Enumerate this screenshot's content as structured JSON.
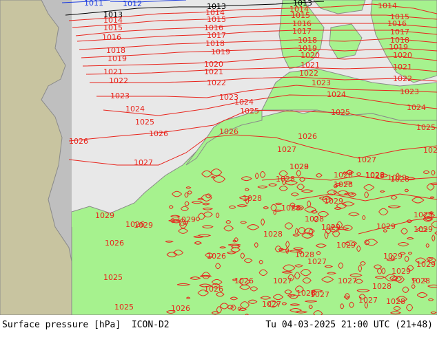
{
  "map": {
    "colors": {
      "land": "#a6f28e",
      "sea": "#e8e8e8",
      "outside_domain": "#bfbfbf",
      "outside_land": "#c8c4a0",
      "isobar_high": "#e8241c",
      "isobar_std": "#000000",
      "isobar_low": "#1f3fe0",
      "coast": "#8a8a8a"
    },
    "standard_isobar_hpa": 1013,
    "isobars": [
      {
        "value": "1011",
        "color": "low"
      },
      {
        "value": "1012",
        "color": "low"
      },
      {
        "value": "1013",
        "color": "std"
      },
      {
        "value": "1014",
        "color": "high"
      },
      {
        "value": "1015",
        "color": "high"
      },
      {
        "value": "1016",
        "color": "high"
      },
      {
        "value": "1017",
        "color": "high"
      },
      {
        "value": "1018",
        "color": "high"
      },
      {
        "value": "1019",
        "color": "high"
      },
      {
        "value": "1020",
        "color": "high"
      },
      {
        "value": "1021",
        "color": "high"
      },
      {
        "value": "1022",
        "color": "high"
      },
      {
        "value": "1023",
        "color": "high"
      },
      {
        "value": "1024",
        "color": "high"
      },
      {
        "value": "1025",
        "color": "high"
      },
      {
        "value": "1026",
        "color": "high"
      },
      {
        "value": "1027",
        "color": "high"
      },
      {
        "value": "1028",
        "color": "high"
      },
      {
        "value": "1029",
        "color": "high"
      }
    ]
  },
  "footer": {
    "left": "Surface pressure [hPa]  ICON-D2",
    "right": "Tu 04-03-2025 21:00 UTC (21+48)"
  }
}
